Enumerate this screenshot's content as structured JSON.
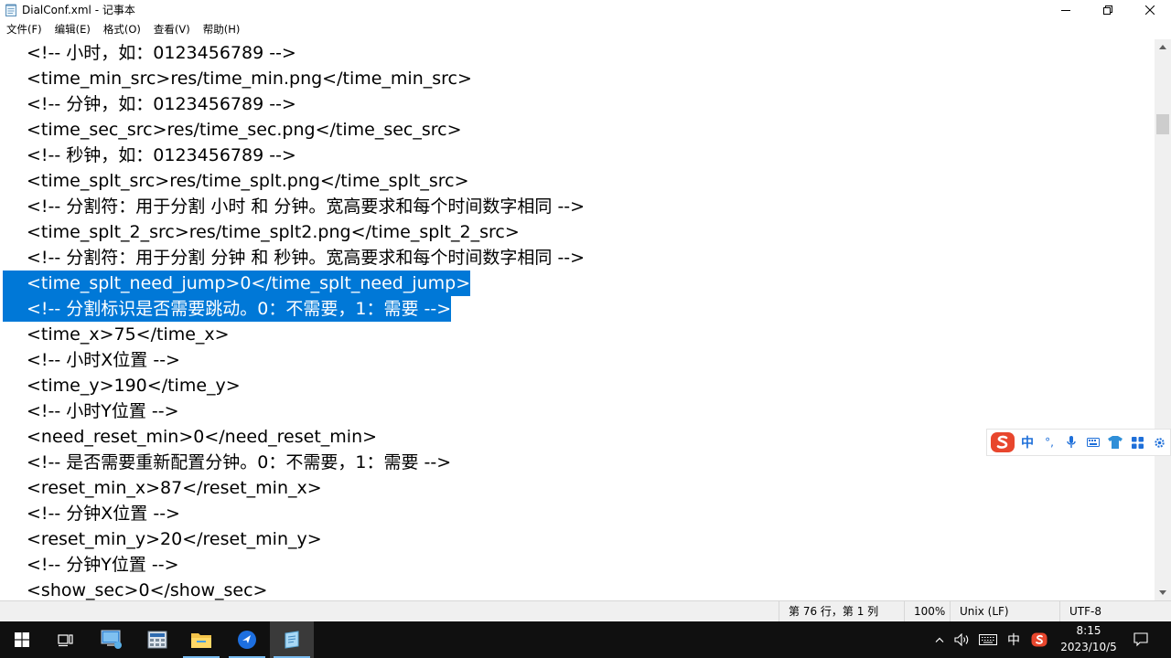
{
  "window": {
    "title": "DialConf.xml - 记事本"
  },
  "menu": [
    "文件(F)",
    "编辑(E)",
    "格式(O)",
    "查看(V)",
    "帮助(H)"
  ],
  "editor": {
    "lines": [
      "<!-- 小时，如：0123456789 -->",
      "<time_min_src>res/time_min.png</time_min_src>",
      "<!-- 分钟，如：0123456789 -->",
      "<time_sec_src>res/time_sec.png</time_sec_src>",
      "<!-- 秒钟，如：0123456789 -->",
      "<time_splt_src>res/time_splt.png</time_splt_src>",
      "<!-- 分割符：用于分割 小时 和 分钟。宽高要求和每个时间数字相同 -->",
      "<time_splt_2_src>res/time_splt2.png</time_splt_2_src>",
      "<!-- 分割符：用于分割 分钟 和 秒钟。宽高要求和每个时间数字相同 -->",
      "<time_splt_need_jump>0</time_splt_need_jump>",
      "<!-- 分割标识是否需要跳动。0：不需要，1：需要 -->",
      "<time_x>75</time_x>",
      "<!-- 小时X位置 -->",
      "<time_y>190</time_y>",
      "<!-- 小时Y位置 -->",
      "<need_reset_min>0</need_reset_min>",
      "<!-- 是否需要重新配置分钟。0：不需要，1：需要 -->",
      "<reset_min_x>87</reset_min_x>",
      "<!-- 分钟X位置 -->",
      "<reset_min_y>20</reset_min_y>",
      "<!-- 分钟Y位置 -->",
      "<show_sec>0</show_sec>"
    ],
    "selected_lines": [
      9,
      10
    ]
  },
  "status": {
    "position": "第 76 行，第 1 列",
    "zoom": "100%",
    "line_ending": "Unix (LF)",
    "encoding": "UTF-8"
  },
  "ime": {
    "mode": "中",
    "punct": "°,"
  },
  "tray": {
    "ime_mode": "中",
    "time": "8:15",
    "date": "2023/10/5"
  },
  "colors": {
    "selection": "#0078d7",
    "taskbar": "#101010",
    "statusbar": "#f0f0f0",
    "sogou": "#e8462d",
    "ime_icon": "#1e6fd9"
  }
}
